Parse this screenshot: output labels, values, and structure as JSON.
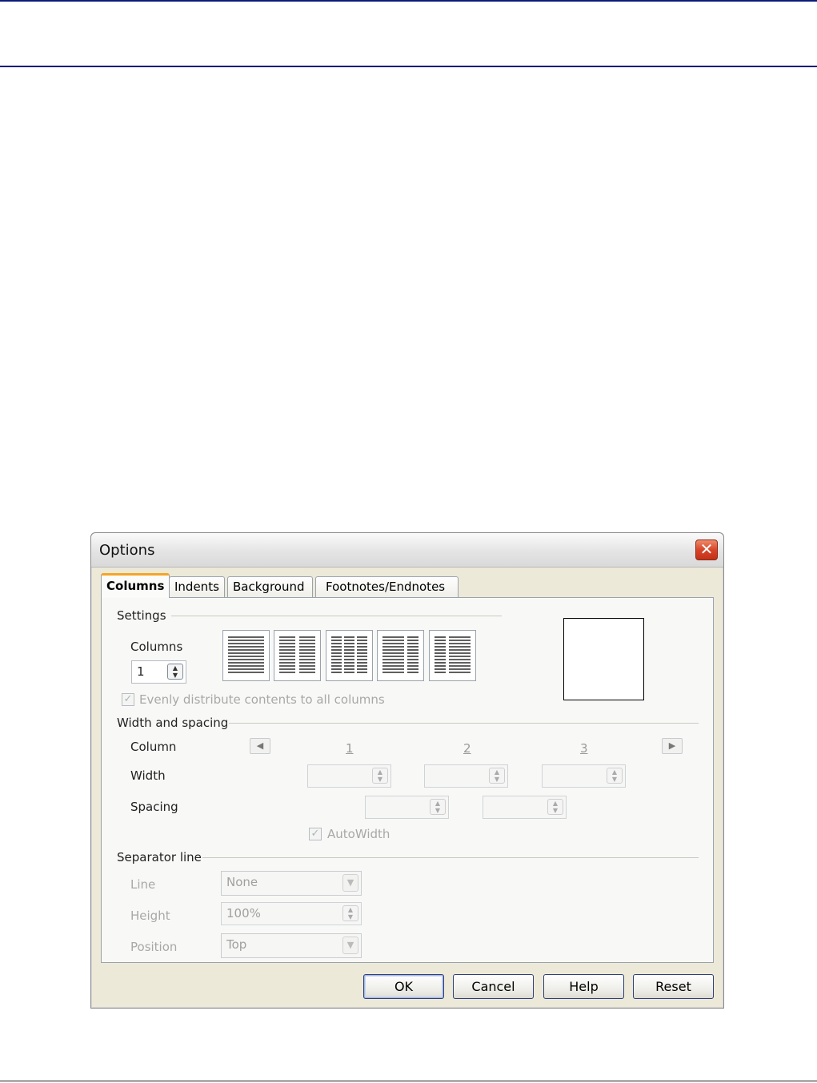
{
  "dialog": {
    "title": "Options",
    "close_glyph": "✕",
    "tabs": [
      {
        "label": "Columns",
        "active": true
      },
      {
        "label": "Indents"
      },
      {
        "label": "Background"
      },
      {
        "label": "Footnotes/Endnotes"
      }
    ],
    "settings": {
      "section_label": "Settings",
      "columns_label": "Columns",
      "columns_value": "1",
      "layout_presets_count": 5,
      "evenly_label": "Evenly distribute contents to all columns",
      "evenly_checked": true
    },
    "width_spacing": {
      "section_label": "Width and spacing",
      "column_label": "Column",
      "column_numbers": [
        "1",
        "2",
        "3"
      ],
      "width_label": "Width",
      "spacing_label": "Spacing",
      "autowidth_label": "AutoWidth",
      "autowidth_checked": true
    },
    "separator": {
      "section_label": "Separator line",
      "line_label": "Line",
      "line_value": "None",
      "height_label": "Height",
      "height_value": "100%",
      "position_label": "Position",
      "position_value": "Top"
    },
    "buttons": {
      "ok": "OK",
      "cancel": "Cancel",
      "help": "Help",
      "reset": "Reset"
    }
  },
  "colors": {
    "rule": "#0b1a7a",
    "tab_highlight": "#f5a524",
    "close_button": "#d8452a"
  }
}
